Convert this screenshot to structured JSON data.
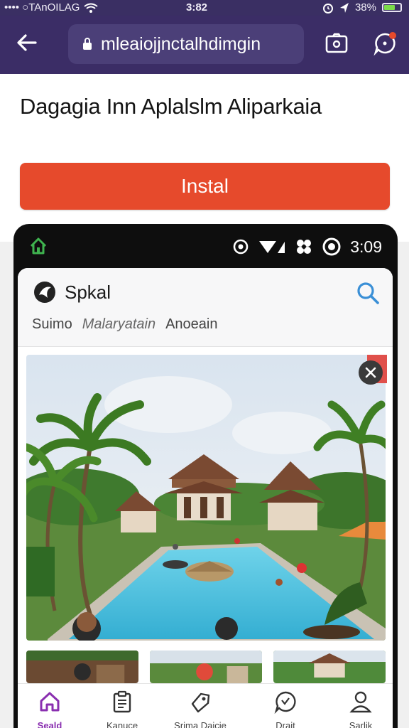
{
  "status_bar": {
    "carrier": "••••  ○TAnOILAG",
    "time": "3:82",
    "battery": "38%"
  },
  "url_bar": {
    "url": "mleaiojjnctalhdimgin"
  },
  "headline": "Dagagia Inn Aplalslm Aliparkaia",
  "install_button": "Instal",
  "phone": {
    "time": "3:09",
    "app_name": "Spkal",
    "tabs": [
      "Suimo",
      "Malaryatain",
      "Anoeain"
    ],
    "nav": [
      {
        "label": "Seald",
        "icon": "home-icon"
      },
      {
        "label": "Kanuce",
        "icon": "clipboard-icon"
      },
      {
        "label": "Srima Daicie",
        "icon": "tag-icon"
      },
      {
        "label": "Drait",
        "icon": "chat-icon"
      },
      {
        "label": "Sarlik",
        "icon": "user-icon"
      }
    ]
  },
  "colors": {
    "topbar": "#3b2d66",
    "install": "#e64a2c",
    "accent": "#8a2fb0",
    "search": "#3a8fd6"
  }
}
